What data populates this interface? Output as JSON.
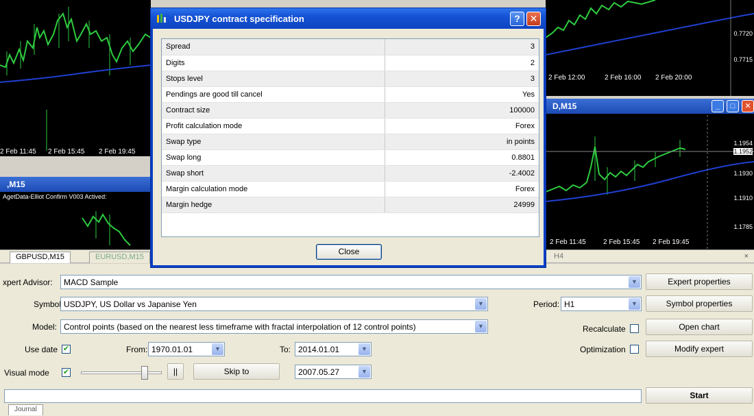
{
  "dialog": {
    "title": "USDJPY contract specification",
    "help_label": "?",
    "close_x_label": "✕",
    "close_button_label": "Close",
    "rows": [
      {
        "key": "Spread",
        "value": "3"
      },
      {
        "key": "Digits",
        "value": "2"
      },
      {
        "key": "Stops level",
        "value": "3"
      },
      {
        "key": "Pendings are good till cancel",
        "value": "Yes"
      },
      {
        "key": "Contract size",
        "value": "100000"
      },
      {
        "key": "Profit calculation mode",
        "value": "Forex"
      },
      {
        "key": "Swap type",
        "value": "in points"
      },
      {
        "key": "Swap long",
        "value": "0.8801"
      },
      {
        "key": "Swap short",
        "value": "-2.4002"
      },
      {
        "key": "Margin calculation mode",
        "value": "Forex"
      },
      {
        "key": "Margin hedge",
        "value": "24999"
      }
    ]
  },
  "charts": {
    "left_top": {
      "times": [
        "2 Feb 11:45",
        "2 Feb 15:45",
        "2 Feb 19:45"
      ]
    },
    "left_bottom": {
      "title": ",M15",
      "comment": "AgetData-Elliot Confirm V003 Actived:"
    },
    "right_top": {
      "times": [
        "2 Feb 12:00",
        "2 Feb 16:00",
        "2 Feb 20:00"
      ],
      "prices": [
        "0.7720",
        "0.7715"
      ]
    },
    "right_bottom": {
      "title": "D,M15",
      "times": [
        "2 Feb 11:45",
        "2 Feb 15:45",
        "2 Feb 19:45"
      ],
      "prices": [
        "1.1954",
        "1.1952",
        "1.1930",
        "1.1910",
        "1.1785"
      ],
      "min_label": "_",
      "max_label": "□",
      "close_label": "✕"
    }
  },
  "tabs": {
    "items": [
      {
        "label": "GBPUSD,M15"
      },
      {
        "label": "EURUSD,M15"
      }
    ],
    "right_partial": "H4",
    "scroll_glyph": "‹",
    "close_glyph": "×"
  },
  "tester": {
    "expert_label": "xpert Advisor:",
    "expert_value": "MACD Sample",
    "symbol_label": "Symbol:",
    "symbol_value": "USDJPY, US Dollar vs Japanise Yen",
    "model_label": "Model:",
    "model_value": "Control points (based on the nearest less timeframe with fractal interpolation of 12 control points)",
    "use_date_label": "Use date",
    "from_label": "From:",
    "from_value": "1970.01.01",
    "to_label": "To:",
    "to_value": "2014.01.01",
    "visual_mode_label": "Visual mode",
    "pause_label": "||",
    "skip_to_label": "Skip to",
    "skip_to_value": "2007.05.27",
    "period_label": "Period:",
    "period_value": "H1",
    "recalculate_label": "Recalculate",
    "optimization_label": "Optimization",
    "expert_properties_label": "Expert properties",
    "symbol_properties_label": "Symbol properties",
    "open_chart_label": "Open chart",
    "modify_expert_label": "Modify expert",
    "start_label": "Start",
    "journal_tab_label": "Journal",
    "dropdown_glyph": "▼",
    "checkmark_glyph": "✔",
    "use_date_checked": true,
    "visual_mode_checked": true,
    "recalculate_checked": false,
    "optimization_checked": false
  }
}
